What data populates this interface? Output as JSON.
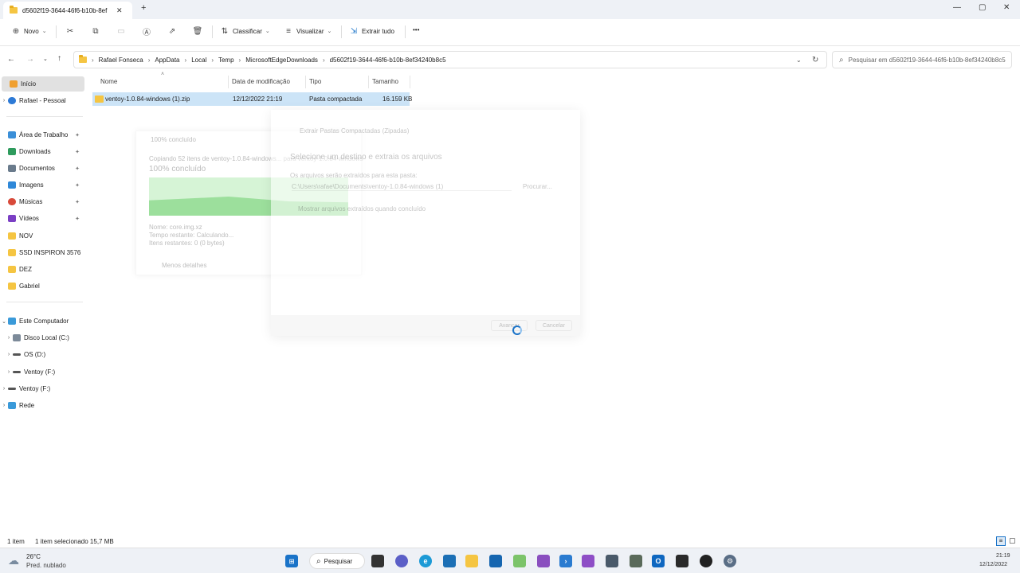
{
  "tab": {
    "title": "d5602f19-3644-46f6-b10b-8ef",
    "close": "✕",
    "new": "+"
  },
  "window": {
    "minimize": "—",
    "maximize": "▢",
    "close": "✕"
  },
  "toolbar": {
    "new_label": "Novo",
    "sort_label": "Classificar",
    "view_label": "Visualizar",
    "extract_label": "Extrair tudo",
    "more": "•••"
  },
  "address": {
    "crumbs": [
      "Rafael Fonseca",
      "AppData",
      "Local",
      "Temp",
      "MicrosoftEdgeDownloads",
      "d5602f19-3644-46f6-b10b-8ef34240b8c5"
    ]
  },
  "search": {
    "placeholder": "Pesquisar em d5602f19-3644-46f6-b10b-8ef34240b8c5"
  },
  "sidebar": {
    "home": "Início",
    "onedrive": "Rafael - Pessoal",
    "pinned": [
      "Área de Trabalho",
      "Downloads",
      "Documentos",
      "Imagens",
      "Músicas",
      "Vídeos"
    ],
    "folders": [
      "NOV",
      "SSD INSPIRON 3576",
      "DEZ",
      "Gabriel"
    ],
    "computer": "Este Computador",
    "drives": [
      "Disco Local (C:)",
      "OS (D:)",
      "Ventoy (F:)"
    ],
    "ventoy": "Ventoy (F:)",
    "network": "Rede"
  },
  "columns": {
    "name": "Nome",
    "date": "Data de modificação",
    "type": "Tipo",
    "size": "Tamanho"
  },
  "files": [
    {
      "name": "ventoy-1.0.84-windows (1).zip",
      "date": "12/12/2022 21:19",
      "type": "Pasta compactada",
      "size": "16.159 KB"
    }
  ],
  "copy_dialog": {
    "title": "100% concluído",
    "line": "Copiando 52 itens de ventoy-1.0.84-windows... para ventoy-1.0.84-windows",
    "percent": "100% concluído",
    "name": "Nome: core.img.xz",
    "remaining": "Tempo restante: Calculando...",
    "items": "Itens restantes: 0 (0 bytes)",
    "less": "Menos detalhes"
  },
  "extract_dialog": {
    "title": "Extrair Pastas Compactadas (Zipadas)",
    "heading": "Selecione um destino e extraia os arquivos",
    "label": "Os arquivos serão extraídos para esta pasta:",
    "path": "C:\\Users\\rafae\\Documents\\ventoy-1.0.84-windows (1)",
    "browse": "Procurar...",
    "checkbox": "Mostrar arquivos extraídos quando concluído",
    "next": "Avançar",
    "cancel": "Cancelar"
  },
  "status": {
    "count": "1 item",
    "selected": "1 item selecionado 15,7 MB"
  },
  "taskbar": {
    "temp": "26°C",
    "weather": "Pred. nublado",
    "search": "Pesquisar",
    "time": "21:19",
    "date": "12/12/2022"
  }
}
